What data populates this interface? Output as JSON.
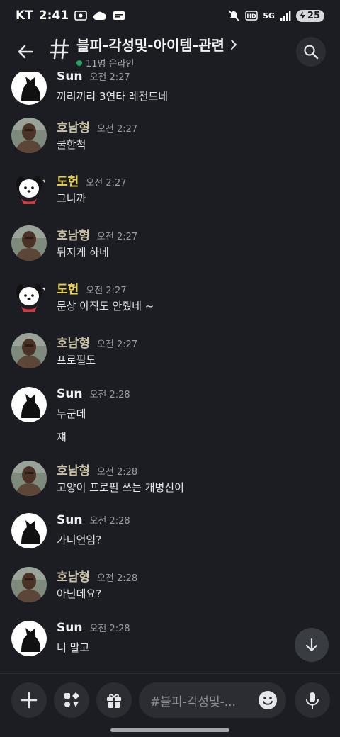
{
  "status_bar": {
    "carrier": "KT",
    "time": "2:41",
    "network": "5G",
    "battery": "25"
  },
  "header": {
    "channel_name": "블피-각성및-아이템-관련",
    "online_count": "11명 온라인"
  },
  "messages": [
    {
      "author": "Sun",
      "time": "오전 2:27",
      "lines": [
        "끼리끼리 3연타 레전드네"
      ],
      "avatar": "cat-avatar"
    },
    {
      "author": "호남형",
      "time": "오전 2:27",
      "lines": [
        "쿨한척"
      ],
      "avatar": "photo-avatar"
    },
    {
      "author": "도헌",
      "time": "오전 2:27",
      "lines": [
        "그니까"
      ],
      "avatar": "pochacco-avatar"
    },
    {
      "author": "호남형",
      "time": "오전 2:27",
      "lines": [
        "뒤지게 하네"
      ],
      "avatar": "photo-avatar"
    },
    {
      "author": "도헌",
      "time": "오전 2:27",
      "lines": [
        "문상 아직도 안줬네 ~"
      ],
      "avatar": "pochacco-avatar"
    },
    {
      "author": "호남형",
      "time": "오전 2:27",
      "lines": [
        "프로필도"
      ],
      "avatar": "photo-avatar"
    },
    {
      "author": "Sun",
      "time": "오전 2:28",
      "lines": [
        "누군데",
        "쟤"
      ],
      "avatar": "cat-avatar"
    },
    {
      "author": "호남형",
      "time": "오전 2:28",
      "lines": [
        "고양이 프로필 쓰는 개병신이"
      ],
      "avatar": "photo-avatar"
    },
    {
      "author": "Sun",
      "time": "오전 2:28",
      "lines": [
        "가디언임?"
      ],
      "avatar": "cat-avatar"
    },
    {
      "author": "호남형",
      "time": "오전 2:28",
      "lines": [
        "아닌데요?"
      ],
      "avatar": "photo-avatar"
    },
    {
      "author": "Sun",
      "time": "오전 2:28",
      "lines": [
        "너 말고"
      ],
      "avatar": "cat-avatar"
    }
  ],
  "composer": {
    "placeholder": "#블피-각성및-..."
  },
  "icons": [
    "back-arrow-icon",
    "hash-icon",
    "chevron-right-icon",
    "search-icon",
    "plus-icon",
    "apps-icon",
    "gift-icon",
    "emoji-icon",
    "microphone-icon",
    "arrow-down-icon"
  ],
  "colors": {
    "background": "#1c1d22",
    "online": "#23a55a",
    "doheon_name": "#e7d24a"
  }
}
